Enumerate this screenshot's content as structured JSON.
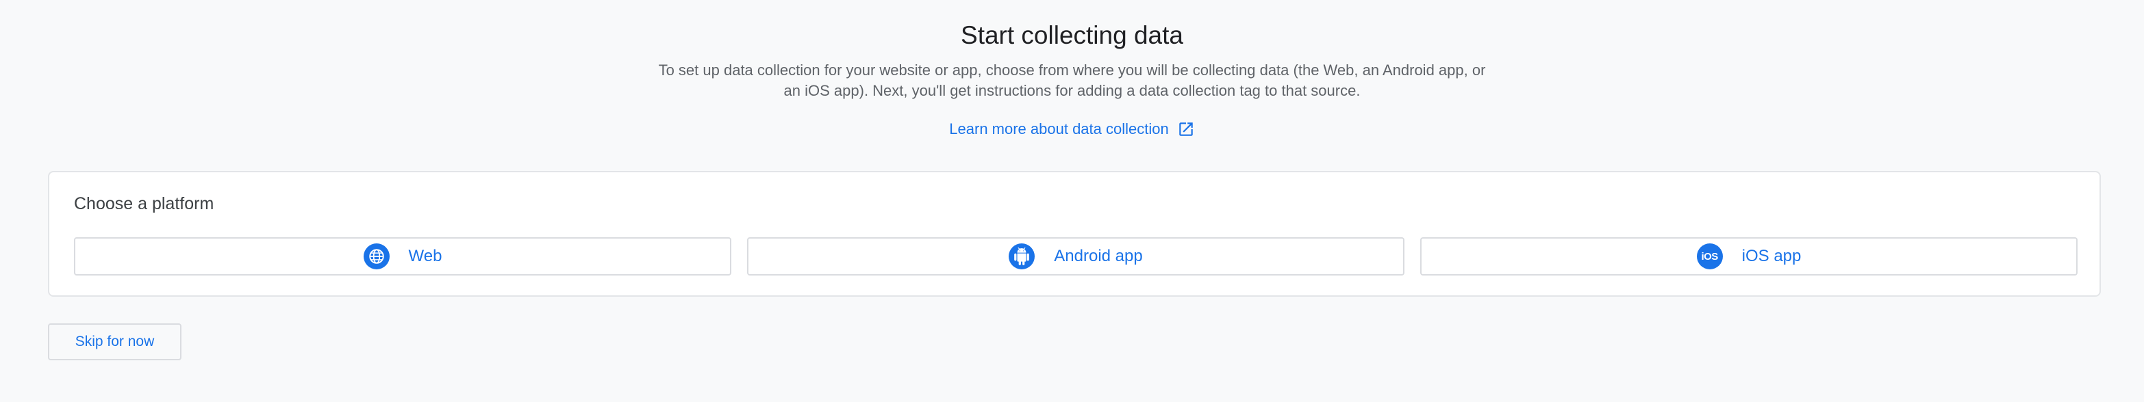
{
  "header": {
    "title": "Start collecting data",
    "description": "To set up data collection for your website or app, choose from where you will be collecting data (the Web, an Android app, or an iOS app). Next, you'll get instructions for adding a data collection tag to that source.",
    "learn_more_label": "Learn more about data collection",
    "learn_more_icon": "open-in-new-icon"
  },
  "platform_card": {
    "title": "Choose a platform",
    "options": [
      {
        "label": "Web",
        "icon": "globe-icon"
      },
      {
        "label": "Android app",
        "icon": "android-icon"
      },
      {
        "label": "iOS app",
        "icon": "ios-icon",
        "icon_text": "iOS"
      }
    ]
  },
  "footer": {
    "skip_label": "Skip for now"
  },
  "colors": {
    "accent": "#1a73e8",
    "background": "#f8f9fa",
    "border": "#dadce0",
    "text_primary": "#202124",
    "text_secondary": "#5f6368"
  }
}
